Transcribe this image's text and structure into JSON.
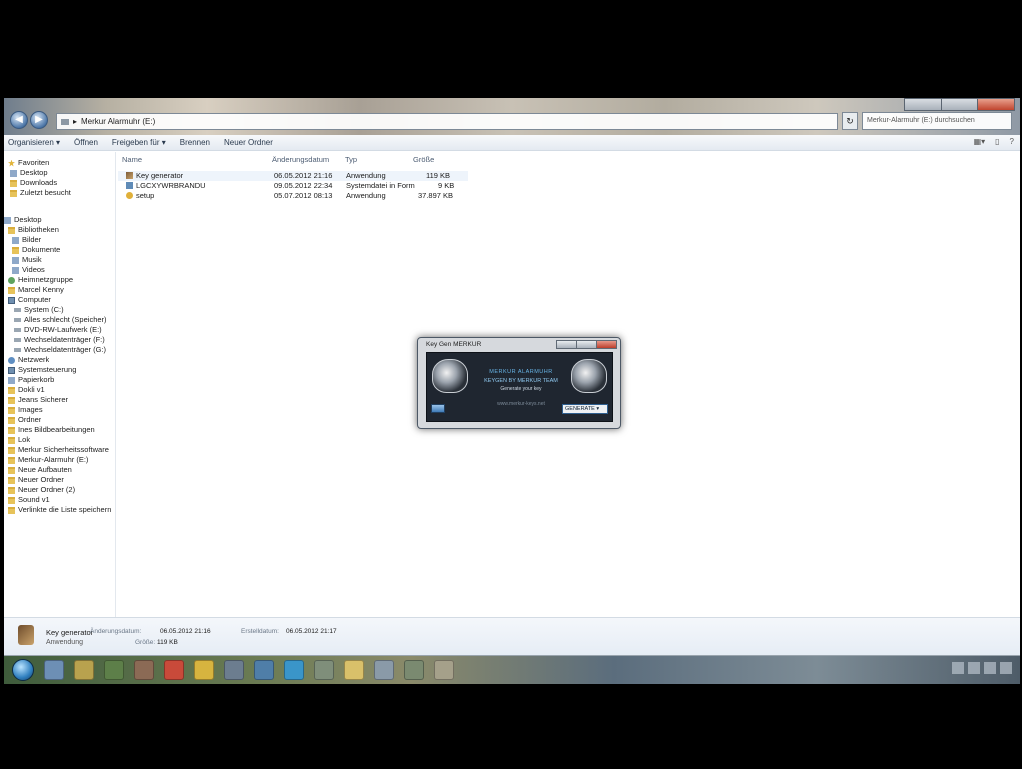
{
  "window": {
    "address": "Merkur Alarmuhr (E:)",
    "search_placeholder": "Merkur-Alarmuhr (E:) durchsuchen"
  },
  "toolbar": {
    "organize": "Organisieren ▾",
    "open": "Öffnen",
    "share": "Freigeben für ▾",
    "burn": "Brennen",
    "new_folder": "Neuer Ordner"
  },
  "nav": {
    "favorites": "Favoriten",
    "desktop": "Desktop",
    "downloads": "Downloads",
    "recent": "Zuletzt besucht",
    "desktop_root": "Desktop",
    "libraries": "Bibliotheken",
    "pictures": "Bilder",
    "documents": "Dokumente",
    "music": "Musik",
    "videos": "Videos",
    "homegroup": "Heimnetzgruppe",
    "user": "Marcel Kenny",
    "computer": "Computer",
    "drive_c": "System (C:)",
    "drive_d": "Alles schlecht (Speicher)",
    "drive_e": "DVD-RW-Laufwerk (E:)",
    "drive_f": "Wechseldatenträger (F:)",
    "drive_g": "Wechseldatenträger (G:)",
    "network": "Netzwerk",
    "control": "Systemsteuerung",
    "trash": "Papierkorb",
    "f1": "Dokli v1",
    "f2": "Jeans Sicherer",
    "f3": "Images",
    "f4": "Ordner",
    "f5": "Ines Bildbearbeitungen",
    "f6": "Lok",
    "f7": "Merkur Sicherheitssoftware",
    "f8": "Merkur-Alarmuhr (E:)",
    "f9": "Neue Aufbauten",
    "f10": "Neuer Ordner",
    "f11": "Neuer Ordner (2)",
    "f12": "Sound v1",
    "f13": "Verlinkte die Liste speichern"
  },
  "columns": {
    "name": "Name",
    "modified": "Änderungsdatum",
    "type": "Typ",
    "size": "Größe"
  },
  "files": [
    {
      "name": "Key generator",
      "modified": "06.05.2012 21:16",
      "type": "Anwendung",
      "size": "119 KB"
    },
    {
      "name": "LGCXYWRBRANDU",
      "modified": "09.05.2012 22:34",
      "type": "Systemdatei in Form",
      "size": "9 KB"
    },
    {
      "name": "setup",
      "modified": "05.07.2012 08:13",
      "type": "Anwendung",
      "size": "37.897 KB"
    }
  ],
  "dialog": {
    "title": "Key Gen MERKUR",
    "caption1": "MERKUR ALARMUHR",
    "caption2": "KEYGEN BY MERKUR TEAM",
    "caption3": "Generate your key",
    "caption4": "www.merkur-keys.net",
    "select": "GENERATE"
  },
  "details": {
    "name": "Key generator",
    "type": "Anwendung",
    "modified_label": "Änderungsdatum:",
    "modified_value": "06.05.2012 21:16",
    "size_label": "Größe:",
    "size_value": "119 KB",
    "created_label": "Erstelldatum:",
    "created_value": "06.05.2012 21:17"
  }
}
